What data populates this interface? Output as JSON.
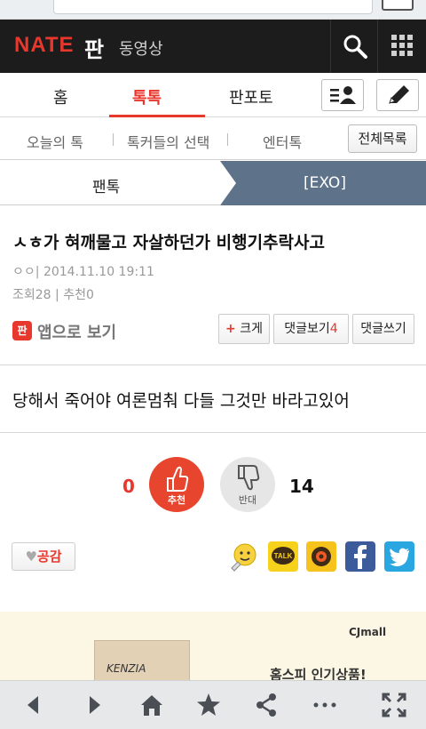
{
  "header": {
    "logo_text": "NATE",
    "service": "판",
    "secondary": "동영상"
  },
  "tabs": [
    {
      "label": "홈"
    },
    {
      "label": "톡톡"
    },
    {
      "label": "판포토"
    }
  ],
  "subnav": {
    "items": [
      "오늘의 톡",
      "톡커들의 선택",
      "엔터톡"
    ],
    "all_button": "전체목록"
  },
  "breadcrumb": {
    "left": "팬톡",
    "right": "[EXO]"
  },
  "article": {
    "title": "ㅅㅎ가 혀깨물고 자살하던가 비행기추락사고",
    "author": "ㅇㅇ",
    "date": "2014.11.10 19:11",
    "views": "조회28",
    "recommends": "추천0",
    "app_label": "앱으로 보기",
    "app_icon_text": "판",
    "btn_big_plus": "+",
    "btn_big": "크게",
    "btn_comments": "댓글보기",
    "comment_count": "4",
    "btn_write_comment": "댓글쓰기",
    "body": "당해서 죽어야 여론멈춰 다들 그것만 바라고있어"
  },
  "votes": {
    "up_count": "0",
    "up_label": "추천",
    "down_label": "반대",
    "down_count": "14"
  },
  "empathy_label": "공감",
  "share_icons": [
    "emoji-icon",
    "kakaotalk-icon",
    "kakaostory-icon",
    "facebook-icon",
    "twitter-icon"
  ],
  "share_talk_text": "TALK",
  "ad": {
    "brand": "CJmall",
    "product_logo": "KENZIA",
    "headline": "홈스피 인기상품!"
  },
  "colors": {
    "accent": "#e8372c",
    "header_bg": "#1c1c1c",
    "crumb_right_bg": "#5e738a"
  }
}
